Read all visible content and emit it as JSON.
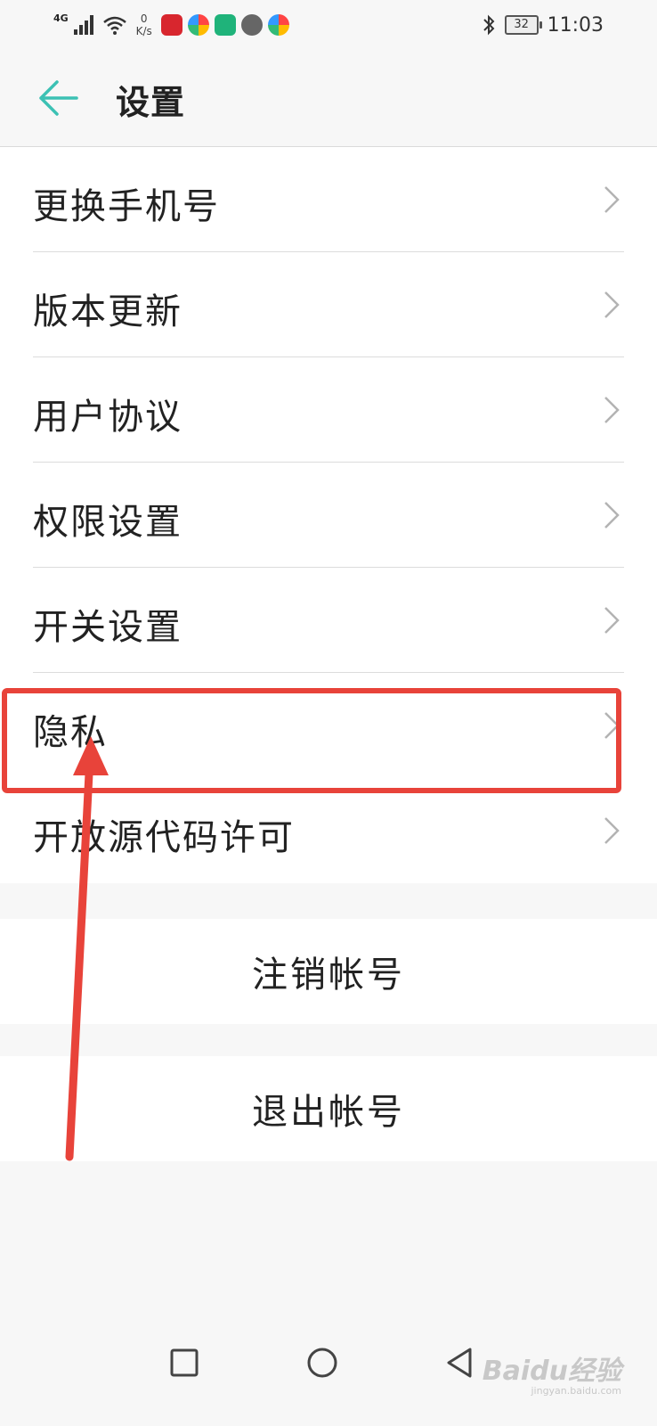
{
  "status_bar": {
    "network_type": "4G",
    "speed_value": "0",
    "speed_unit": "K/s",
    "time": "11:03",
    "battery": "32"
  },
  "app_bar": {
    "title": "设置"
  },
  "settings": {
    "items": [
      {
        "label": "更换手机号"
      },
      {
        "label": "版本更新"
      },
      {
        "label": "用户协议"
      },
      {
        "label": "权限设置"
      },
      {
        "label": "开关设置"
      },
      {
        "label": "隐私"
      },
      {
        "label": "开放源代码许可"
      }
    ]
  },
  "actions": {
    "cancel_account": "注销帐号",
    "logout": "退出帐号"
  },
  "annotation": {
    "color": "#e8433a"
  },
  "watermark": {
    "text": "Baidu经验",
    "sub": "jingyan.baidu.com"
  },
  "colors": {
    "accent": "#3cc1b4",
    "background": "#f7f7f7",
    "card": "#ffffff"
  }
}
